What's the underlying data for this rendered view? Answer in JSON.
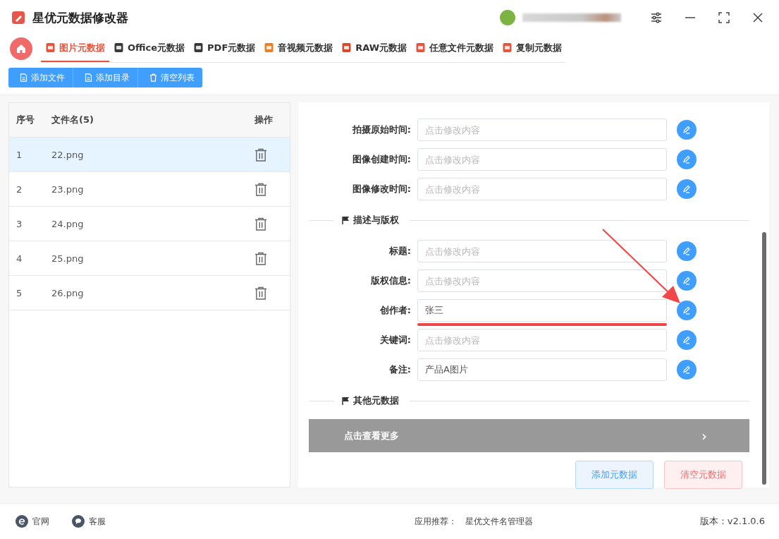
{
  "window": {
    "title": "星优元数据修改器"
  },
  "tabs": [
    {
      "label": "图片元数据",
      "selected": true
    },
    {
      "label": "Office元数据",
      "selected": false
    },
    {
      "label": "PDF元数据",
      "selected": false
    },
    {
      "label": "音视频元数据",
      "selected": false
    },
    {
      "label": "RAW元数据",
      "selected": false
    },
    {
      "label": "任意文件元数据",
      "selected": false
    },
    {
      "label": "复制元数据",
      "selected": false
    }
  ],
  "toolbar": [
    "添加文件",
    "添加目录",
    "清空列表"
  ],
  "file_table": {
    "columns": [
      "序号",
      "文件名(5)",
      "操作"
    ],
    "rows": [
      {
        "index": "1",
        "name": "22.png",
        "selected": true
      },
      {
        "index": "2",
        "name": "23.png",
        "selected": false
      },
      {
        "index": "3",
        "name": "24.png",
        "selected": false
      },
      {
        "index": "4",
        "name": "25.png",
        "selected": false
      },
      {
        "index": "5",
        "name": "26.png",
        "selected": false
      }
    ]
  },
  "form": [
    {
      "fields": [
        {
          "label": "拍摄原始时间:",
          "placeholder": "点击修改内容"
        },
        {
          "label": "图像创建时间:",
          "placeholder": "点击修改内容"
        },
        {
          "label": "图像修改时间:",
          "placeholder": "点击修改内容"
        }
      ]
    },
    {
      "heading": "描述与版权",
      "fields": [
        {
          "label": "标题:",
          "placeholder": "点击修改内容"
        },
        {
          "label": "版权信息:",
          "placeholder": "点击修改内容"
        },
        {
          "label": "创作者:",
          "value": "张三"
        },
        {
          "label": "关键词:",
          "placeholder": "点击修改内容"
        },
        {
          "label": "备注:",
          "value": "产品A图片"
        }
      ]
    },
    {
      "heading": "其他元数据"
    }
  ],
  "more_bar": {
    "label": "点击查看更多",
    "chevron": "›"
  },
  "actions": [
    {
      "label": "添加元数据",
      "kind": "primary"
    },
    {
      "label": "清空元数据",
      "kind": "danger"
    }
  ],
  "status_bar": {
    "links": [
      "官网",
      "客服"
    ],
    "recommend_label": "应用推荐：",
    "recommend_app": "星优文件名管理器",
    "version": "版本：v2.1.0.6"
  }
}
